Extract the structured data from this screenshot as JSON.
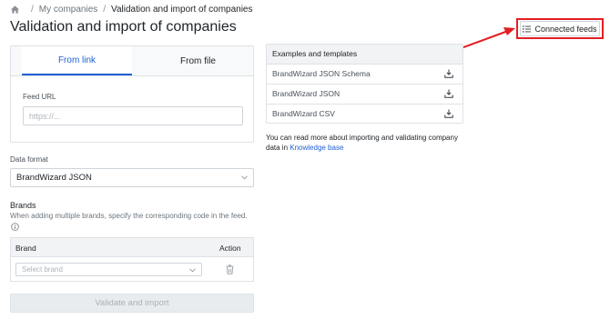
{
  "breadcrumb": {
    "items": [
      "My companies",
      "Validation and import of companies"
    ],
    "separator": "/"
  },
  "page": {
    "title": "Validation and import of companies"
  },
  "header": {
    "connected_feeds_label": "Connected feeds"
  },
  "import_card": {
    "tabs": [
      {
        "label": "From link",
        "active": true
      },
      {
        "label": "From file",
        "active": false
      }
    ],
    "feed_url_label": "Feed URL",
    "feed_url_value": "",
    "feed_url_placeholder": "https://..."
  },
  "data_format": {
    "label": "Data format",
    "selected": "BrandWizard JSON"
  },
  "brands": {
    "title": "Brands",
    "hint": "When adding multiple brands, specify the corresponding code in the feed.",
    "columns": [
      "Brand",
      "Action"
    ],
    "row": {
      "select_placeholder": "Select brand"
    }
  },
  "submit_label": "Validate and import",
  "examples": {
    "title": "Examples and templates",
    "items": [
      {
        "label": "BrandWizard JSON Schema",
        "icon": "download-icon"
      },
      {
        "label": "BrandWizard JSON",
        "icon": "download-icon"
      },
      {
        "label": "BrandWizard CSV",
        "icon": "download-icon"
      }
    ]
  },
  "note": {
    "text": "You can read more about importing and validating company data in ",
    "link": "Knowledge base"
  },
  "colors": {
    "accent": "#1f5fd6",
    "annotation": "#e31e24"
  }
}
